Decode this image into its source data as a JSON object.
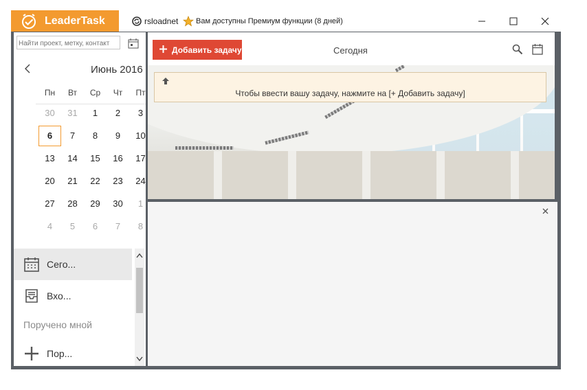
{
  "app": {
    "brand_name": "LeaderTask",
    "user_name": "rsloadnet",
    "premium_notice": "Вам доступны Премиум функции (8 дней)"
  },
  "colors": {
    "brand": "#f39a2f",
    "add_button": "#df4834",
    "frame": "#5b6066",
    "hint_bg": "#fdf3e3"
  },
  "icons": [
    "clock-check-logo-icon",
    "sync-user-icon",
    "star-icon",
    "minimize-icon",
    "maximize-icon",
    "close-icon",
    "calendar-view-icon",
    "chevron-left-icon",
    "today-calendar-icon",
    "inbox-icon",
    "plus-icon",
    "search-icon",
    "arrow-up-icon",
    "scroll-up-icon",
    "scroll-down-icon"
  ],
  "sidebar": {
    "search_placeholder": "Найти проект, метку, контакт",
    "calendar": {
      "month_label": "Июнь 2016",
      "weekdays": [
        "Пн",
        "Вт",
        "Ср",
        "Чт",
        "Пт"
      ],
      "weeks": [
        [
          "30",
          "31",
          "1",
          "2",
          "3"
        ],
        [
          "6",
          "7",
          "8",
          "9",
          "10"
        ],
        [
          "13",
          "14",
          "15",
          "16",
          "17"
        ],
        [
          "20",
          "21",
          "22",
          "23",
          "24"
        ],
        [
          "27",
          "28",
          "29",
          "30",
          "1"
        ],
        [
          "4",
          "5",
          "6",
          "7",
          "8"
        ]
      ]
    },
    "items": [
      {
        "label": "Сего..."
      },
      {
        "label": "Вхо..."
      }
    ],
    "section_header": "Поручено мной",
    "add_item_label": "Пор..."
  },
  "main": {
    "add_button_label": "Добавить задачу",
    "view_title": "Сегодня",
    "hint_text": "Чтобы ввести вашу задачу, нажмите на [+ Добавить задачу]"
  }
}
